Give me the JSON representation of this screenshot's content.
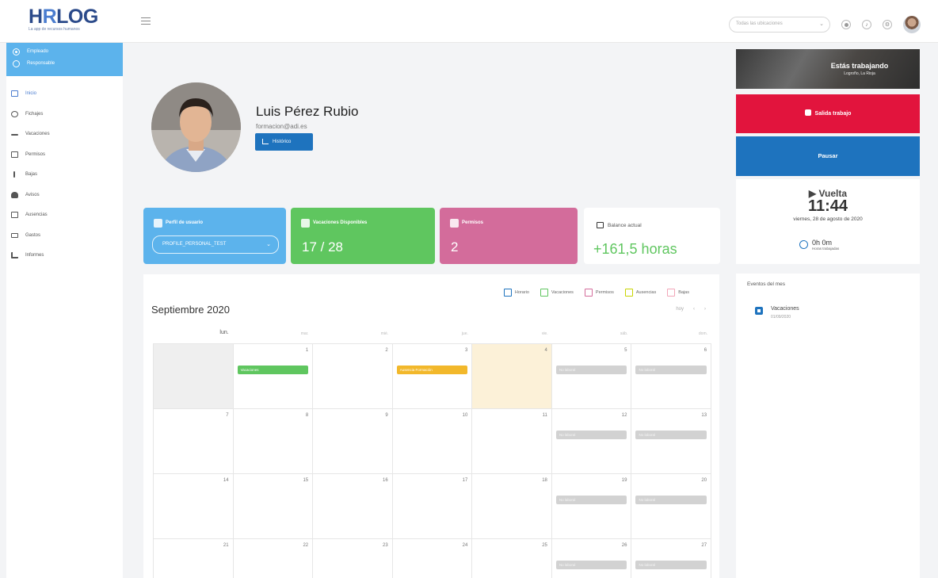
{
  "app": {
    "logo_text_a": "H",
    "logo_text_r": "R",
    "logo_text_rest": "LOG",
    "logo_tagline": "La app de recursos humanos"
  },
  "topbar": {
    "location_select": "Todas las ubicaciones"
  },
  "sidebar": {
    "roles": [
      {
        "label": "Empleado",
        "selected": true
      },
      {
        "label": "Responsable",
        "selected": false
      }
    ],
    "items": [
      {
        "label": "Inicio",
        "icon": "monitor-icon",
        "active": true
      },
      {
        "label": "Fichajes",
        "icon": "clock-icon"
      },
      {
        "label": "Vacaciones",
        "icon": "plane-icon"
      },
      {
        "label": "Permisos",
        "icon": "calendar-icon"
      },
      {
        "label": "Bajas",
        "icon": "medical-icon"
      },
      {
        "label": "Avisos",
        "icon": "bell-icon"
      },
      {
        "label": "Ausencias",
        "icon": "document-icon"
      },
      {
        "label": "Gastos",
        "icon": "wallet-icon"
      },
      {
        "label": "Informes",
        "icon": "chart-icon"
      }
    ]
  },
  "profile": {
    "name": "Luis Pérez Rubio",
    "email": "formacion@adi.es",
    "history_button": "Histórico"
  },
  "cards": {
    "profile": {
      "title": "Perfil de usuario",
      "select_value": "PROFILE_PERSONAL_TEST"
    },
    "vacations": {
      "title": "Vacaciones Disponibles",
      "value": "17 / 28"
    },
    "permits": {
      "title": "Permisos",
      "value": "2"
    },
    "balance": {
      "title": "Balance actual",
      "value": "+161,5 horas"
    }
  },
  "calendar": {
    "title": "Septiembre 2020",
    "nav": [
      "hoy",
      "‹",
      "›"
    ],
    "legend": [
      {
        "label": "Horario",
        "color": "#1e73be"
      },
      {
        "label": "Vacaciones",
        "color": "#5fc65f"
      },
      {
        "label": "Permisos",
        "color": "#d36c9b"
      },
      {
        "label": "Ausencias",
        "color": "#c8d400"
      },
      {
        "label": "Bajas",
        "color": "#f2a6b8"
      }
    ],
    "days_of_week": [
      "lun.",
      "mar.",
      "mié.",
      "jue.",
      "vie.",
      "sáb.",
      "dom."
    ],
    "weeks": [
      [
        {
          "n": "",
          "empty": true
        },
        {
          "n": "1",
          "evt": "Vacaciones",
          "evt_color": "green"
        },
        {
          "n": "2"
        },
        {
          "n": "3",
          "evt": "Ausencia Formación",
          "evt_color": "yellow"
        },
        {
          "n": "4",
          "today": true
        },
        {
          "n": "5",
          "evt": "No laboral",
          "evt_color": "gray"
        },
        {
          "n": "6",
          "evt": "No laboral",
          "evt_color": "gray"
        }
      ],
      [
        {
          "n": "7"
        },
        {
          "n": "8"
        },
        {
          "n": "9"
        },
        {
          "n": "10"
        },
        {
          "n": "11"
        },
        {
          "n": "12",
          "evt": "No laboral",
          "evt_color": "gray"
        },
        {
          "n": "13",
          "evt": "No laboral",
          "evt_color": "gray"
        }
      ],
      [
        {
          "n": "14"
        },
        {
          "n": "15"
        },
        {
          "n": "16"
        },
        {
          "n": "17"
        },
        {
          "n": "18"
        },
        {
          "n": "19",
          "evt": "No laboral",
          "evt_color": "gray"
        },
        {
          "n": "20",
          "evt": "No laboral",
          "evt_color": "gray"
        }
      ],
      [
        {
          "n": "21"
        },
        {
          "n": "22"
        },
        {
          "n": "23"
        },
        {
          "n": "24"
        },
        {
          "n": "25"
        },
        {
          "n": "26",
          "evt": "No laboral",
          "evt_color": "gray"
        },
        {
          "n": "27",
          "evt": "No laboral",
          "evt_color": "gray"
        }
      ]
    ]
  },
  "status": {
    "working_title": "Estás trabajando",
    "working_location": "Logroño, La Rioja",
    "exit_button": "Salida trabajo",
    "pause_button": "Pausar",
    "next_label": "▶ Vuelta",
    "next_time": "11:44",
    "date": "viernes, 28 de agosto de 2020",
    "worked_value": "0h 0m",
    "worked_label": "Horas trabajadas"
  },
  "events": {
    "title": "Eventos del mes",
    "items": [
      {
        "name": "Vacaciones",
        "date": "01/09/2020"
      }
    ]
  }
}
